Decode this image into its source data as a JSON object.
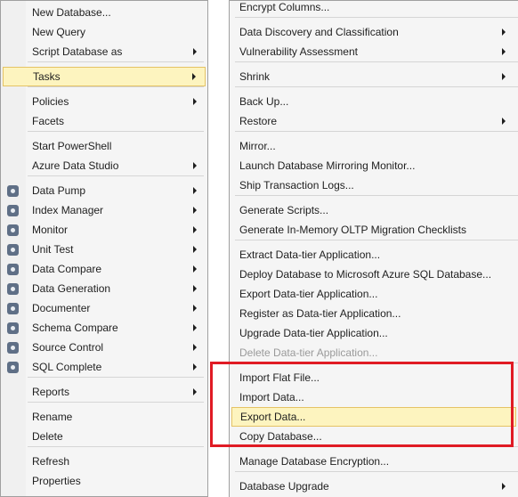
{
  "left_menu": {
    "items": [
      {
        "label": "New Database...",
        "arrow": false
      },
      {
        "label": "New Query",
        "arrow": false
      },
      {
        "label": "Script Database as",
        "arrow": true
      },
      {
        "label": "Tasks",
        "arrow": true,
        "highlighted": true
      },
      {
        "label": "Policies",
        "arrow": true
      },
      {
        "label": "Facets",
        "arrow": false
      },
      {
        "label": "Start PowerShell",
        "arrow": false
      },
      {
        "label": "Azure Data Studio",
        "arrow": true
      },
      {
        "label": "Data Pump",
        "arrow": true,
        "icon": "data-pump-icon"
      },
      {
        "label": "Index Manager",
        "arrow": true,
        "icon": "index-manager-icon"
      },
      {
        "label": "Monitor",
        "arrow": true,
        "icon": "monitor-icon"
      },
      {
        "label": "Unit Test",
        "arrow": true,
        "icon": "unit-test-icon"
      },
      {
        "label": "Data Compare",
        "arrow": true,
        "icon": "data-compare-icon"
      },
      {
        "label": "Data Generation",
        "arrow": true,
        "icon": "data-generation-icon"
      },
      {
        "label": "Documenter",
        "arrow": true,
        "icon": "documenter-icon"
      },
      {
        "label": "Schema Compare",
        "arrow": true,
        "icon": "schema-compare-icon"
      },
      {
        "label": "Source Control",
        "arrow": true,
        "icon": "source-control-icon"
      },
      {
        "label": "SQL Complete",
        "arrow": true,
        "icon": "sql-complete-icon"
      },
      {
        "label": "Reports",
        "arrow": true
      },
      {
        "label": "Rename",
        "arrow": false
      },
      {
        "label": "Delete",
        "arrow": false
      },
      {
        "label": "Refresh",
        "arrow": false
      },
      {
        "label": "Properties",
        "arrow": false
      }
    ]
  },
  "right_menu": {
    "items": [
      {
        "label": "Encrypt Columns...",
        "arrow": false
      },
      {
        "label": "Data Discovery and Classification",
        "arrow": true
      },
      {
        "label": "Vulnerability Assessment",
        "arrow": true
      },
      {
        "label": "Shrink",
        "arrow": true
      },
      {
        "label": "Back Up...",
        "arrow": false
      },
      {
        "label": "Restore",
        "arrow": true
      },
      {
        "label": "Mirror...",
        "arrow": false
      },
      {
        "label": "Launch Database Mirroring Monitor...",
        "arrow": false
      },
      {
        "label": "Ship Transaction Logs...",
        "arrow": false
      },
      {
        "label": "Generate Scripts...",
        "arrow": false
      },
      {
        "label": "Generate In-Memory OLTP Migration Checklists",
        "arrow": false
      },
      {
        "label": "Extract Data-tier Application...",
        "arrow": false
      },
      {
        "label": "Deploy Database to Microsoft Azure SQL Database...",
        "arrow": false
      },
      {
        "label": "Export Data-tier Application...",
        "arrow": false
      },
      {
        "label": "Register as Data-tier Application...",
        "arrow": false
      },
      {
        "label": "Upgrade Data-tier Application...",
        "arrow": false
      },
      {
        "label": "Delete Data-tier Application...",
        "arrow": false,
        "disabled": true
      },
      {
        "label": "Import Flat File...",
        "arrow": false
      },
      {
        "label": "Import Data...",
        "arrow": false
      },
      {
        "label": "Export Data...",
        "arrow": false,
        "highlighted": true
      },
      {
        "label": "Copy Database...",
        "arrow": false
      },
      {
        "label": "Manage Database Encryption...",
        "arrow": false
      },
      {
        "label": "Database Upgrade",
        "arrow": true
      }
    ]
  },
  "colors": {
    "menu_background": "#f5f5f5",
    "highlight_background": "#fdf4bf",
    "highlight_border": "#e5c365",
    "annotation_box": "#e01b24",
    "disabled_text": "#9a9a9a"
  }
}
